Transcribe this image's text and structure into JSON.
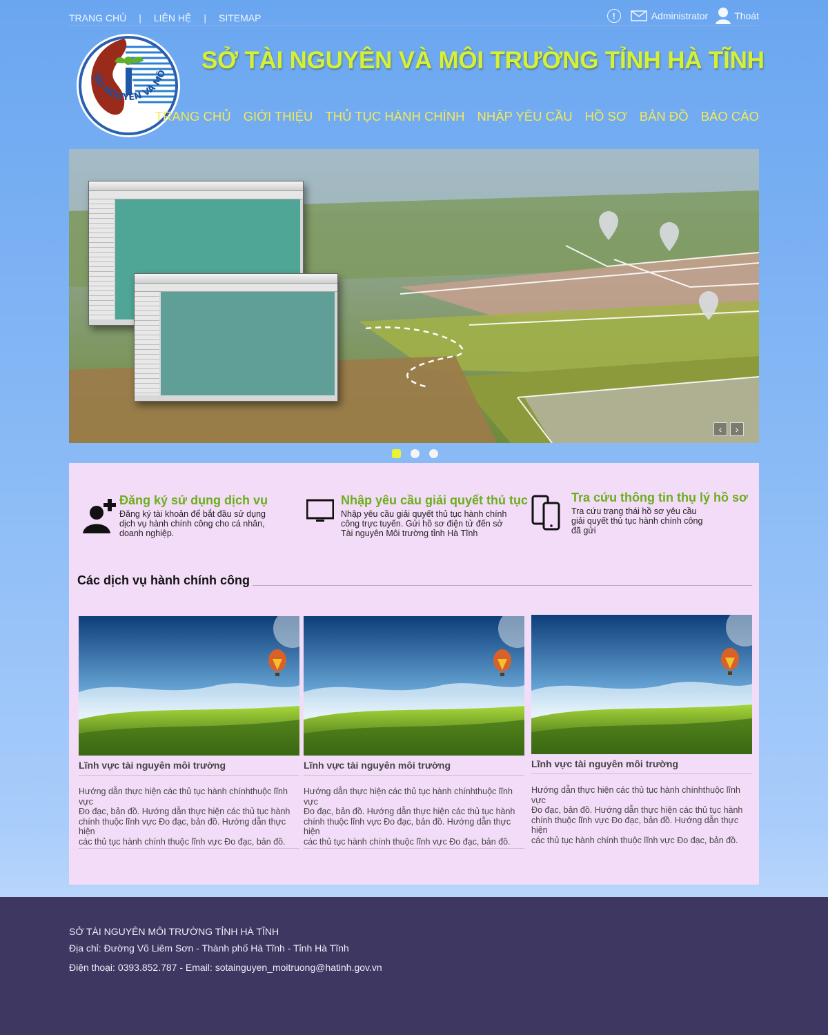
{
  "topbar": {
    "links": [
      "TRANG CHỦ",
      "LIÊN HỆ",
      "SITEMAP"
    ],
    "separator": "|",
    "user": "Administrator",
    "logout": "Thoát"
  },
  "header": {
    "title": "SỞ TÀI NGUYÊN VÀ MÔI TRƯỜNG TỈNH HÀ TĨNH",
    "logo_text": "TÀI NGUYÊN VÀ MÔI TRƯỜNG",
    "nav": [
      "TRANG CHỦ",
      "GIỚI THIỆU",
      "THỦ TỤC HÀNH CHÍNH",
      "NHẬP YÊU CẦU",
      "HỒ SƠ",
      "BẢN ĐỒ",
      "BÁO CÁO"
    ]
  },
  "slider": {
    "prev": "‹",
    "next": "›",
    "active_index": 0,
    "count": 3
  },
  "features": [
    {
      "title": "Đăng ký sử dụng dịch vụ",
      "desc_lines": [
        "Đăng ký tài khoản để bắt đầu sử dụng",
        "dịch vụ hành chính công cho cá nhân,",
        "doanh nghiệp."
      ],
      "icon": "add-user-icon"
    },
    {
      "title": "Nhập yêu cầu giải quyết thủ tục",
      "desc_lines": [
        "Nhập yêu cầu giải quyết thủ tục hành chính",
        "công trực tuyến. Gửi hồ sơ điện tử đến sở",
        "Tài nguyên Môi trường tỉnh Hà Tĩnh"
      ],
      "icon": "monitor-icon"
    },
    {
      "title": "Tra cứu thông tin thụ lý hồ sơ",
      "desc_lines": [
        "Tra cứu trạng thái hồ sơ yêu cầu",
        "giải quyết thủ tục hành chính công",
        "đã gửi"
      ],
      "icon": "devices-icon"
    }
  ],
  "services": {
    "heading": "Các dịch vụ hành chính công",
    "cards": [
      {
        "title": "Lĩnh vực tài nguyên môi trường",
        "desc_lines": [
          "Hướng dẫn thực hiện các thủ tục hành chínhthuộc lĩnh vực",
          "Đo đạc, bản đồ. Hướng dẫn thực hiện các thủ tục hành",
          "chính  thuộc lĩnh vực Đo đạc, bản đồ. Hướng dẫn thực hiện",
          "các thủ tục hành chính thuộc lĩnh vực Đo đạc, bản đồ."
        ]
      },
      {
        "title": "Lĩnh vực tài nguyên môi trường",
        "desc_lines": [
          "Hướng dẫn thực hiện các thủ tục hành chínhthuộc lĩnh vực",
          "Đo đạc, bản đồ. Hướng dẫn thực hiện các thủ tục hành",
          "chính  thuộc lĩnh vực Đo đạc, bản đồ. Hướng dẫn thực hiện",
          "các thủ tục hành chính thuộc lĩnh vực Đo đạc, bản đồ."
        ]
      },
      {
        "title": "Lĩnh vực tài nguyên môi trường",
        "desc_lines": [
          "Hướng dẫn thực hiện các thủ tục hành chínhthuộc lĩnh vực",
          "Đo đạc, bản đồ. Hướng dẫn thực hiện các thủ tục hành",
          "chính  thuộc lĩnh vực Đo đạc, bản đồ. Hướng dẫn thực hiện",
          "các thủ tục hành chính thuộc lĩnh vực Đo đạc, bản đồ."
        ]
      }
    ]
  },
  "footer": {
    "org": "SỞ TÀI NGUYÊN MÔI TRƯỜNG TỈNH HÀ TĨNH",
    "address": "Địa chỉ: Đường Võ Liêm Sơn - Thành phố Hà Tĩnh - Tỉnh Hà Tĩnh",
    "contact": "Điện  thoại: 0393.852.787 - Email: sotainguyen_moitruong@hatinh.gov.vn"
  },
  "colors": {
    "title": "#d6f036",
    "nav": "#f2e95a",
    "feature_title": "#6cae1c",
    "panel": "#f3dcf7",
    "footer": "#3d3762"
  }
}
